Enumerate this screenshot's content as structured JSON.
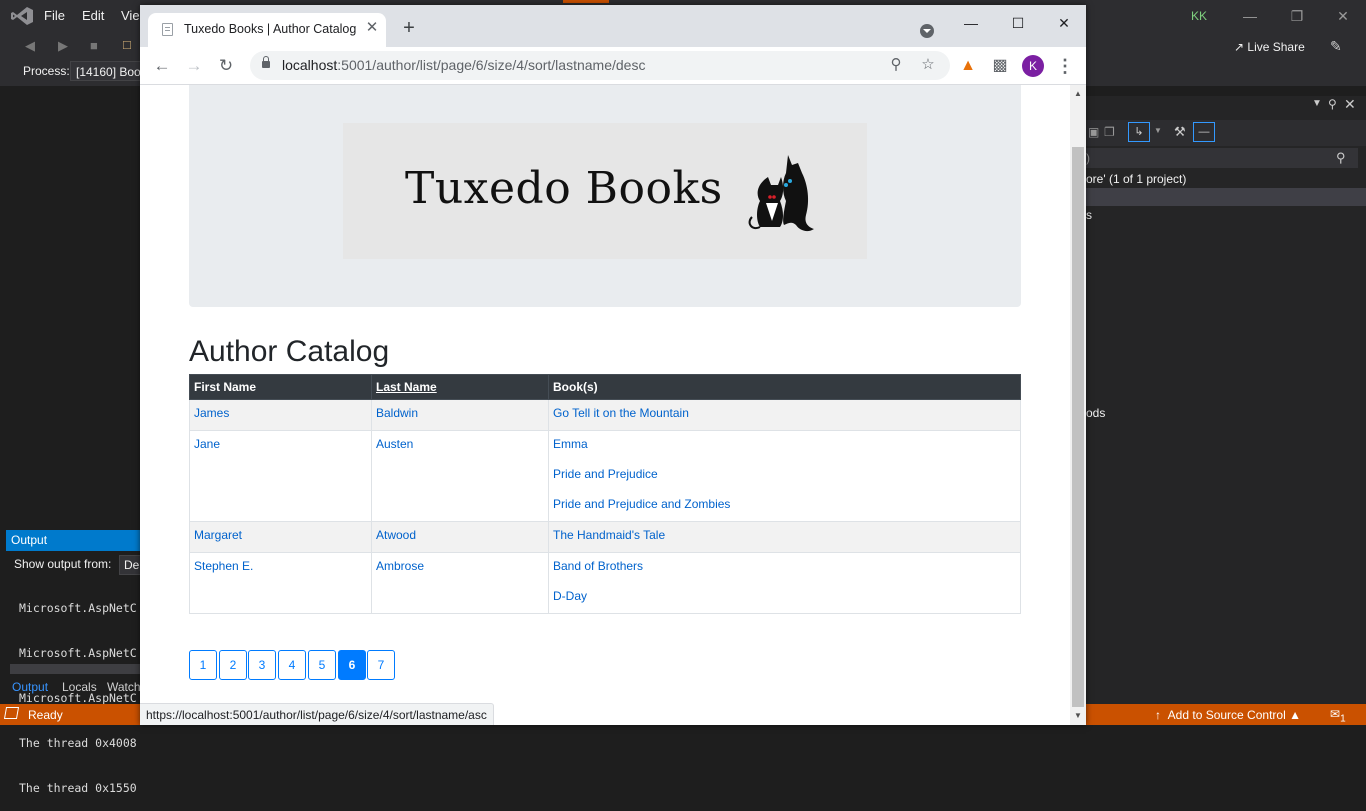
{
  "vs": {
    "menu": [
      "File",
      "Edit",
      "Vie"
    ],
    "user_initials": "KK",
    "process_label": "Process:",
    "process_value": "[14160] Boo",
    "live_share": "Live Share",
    "solution_explorer": {
      "search_placeholder": ")",
      "solution_text": "ore' (1 of 1 project)",
      "item_s": "s",
      "item_ods": "ods"
    },
    "output": {
      "title": "Output",
      "show_from": "Show output from:",
      "source": "De",
      "lines": [
        "Microsoft.AspNetC",
        "Microsoft.AspNetC",
        "Microsoft.AspNetC",
        "The thread 0x4008",
        "The thread 0x1550"
      ],
      "tabs": [
        "Output",
        "Locals",
        "Watch"
      ]
    },
    "status": {
      "ready": "Ready",
      "source_control": "Add to Source Control",
      "notif_count": "1"
    }
  },
  "browser": {
    "tab_title": "Tuxedo Books | Author Catalog",
    "url_host": "localhost",
    "url_rest": ":5001/author/list/page/6/size/4/sort/lastname/desc",
    "profile_initial": "K",
    "hover_url": "https://localhost:5001/author/list/page/6/size/4/sort/lastname/asc"
  },
  "page": {
    "logo_text": "Tuxedo Books",
    "title": "Author Catalog",
    "headers": {
      "first": "First Name",
      "last": "Last Name",
      "books": "Book(s)"
    },
    "authors": [
      {
        "first": "James",
        "last": "Baldwin",
        "books": [
          "Go Tell it on the Mountain"
        ]
      },
      {
        "first": "Jane",
        "last": "Austen",
        "books": [
          "Emma",
          "Pride and Prejudice",
          "Pride and Prejudice and Zombies"
        ]
      },
      {
        "first": "Margaret",
        "last": "Atwood",
        "books": [
          "The Handmaid's Tale"
        ]
      },
      {
        "first": "Stephen E.",
        "last": "Ambrose",
        "books": [
          "Band of Brothers",
          "D-Day"
        ]
      }
    ],
    "pages": [
      "1",
      "2",
      "3",
      "4",
      "5",
      "6",
      "7"
    ],
    "current_page": "6"
  },
  "colors": {
    "link": "#0062cc",
    "header_bg": "#343a40",
    "primary": "#007bff",
    "vs_status": "#ca5100"
  }
}
